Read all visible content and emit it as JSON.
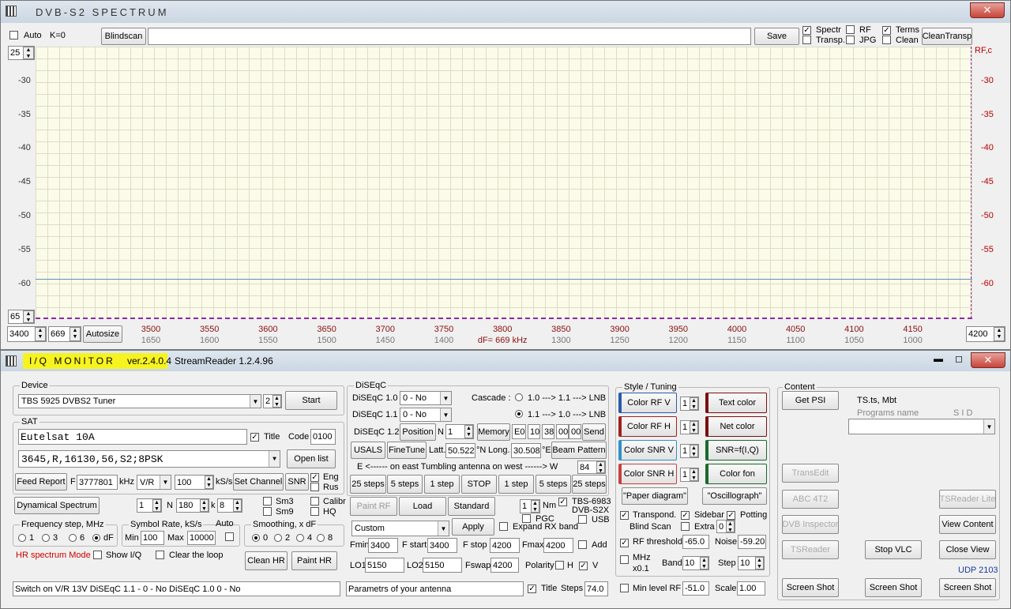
{
  "spectrum": {
    "title": "DVB-S2   SPECTRUM",
    "auto_label": "Auto",
    "k_label": "K=0",
    "blindscan": "Blindscan",
    "save": "Save",
    "checks": {
      "spectr": "Spectr",
      "transp": "Transp.",
      "rf": "RF",
      "jpg": "JPG",
      "terms": "Terms",
      "clean": "Clean"
    },
    "cleantransp": "CleanTransp",
    "top_value": "25",
    "bottom_value": "65",
    "right_label": "RF,c",
    "y_ticks": [
      "-30",
      "-35",
      "-40",
      "-45",
      "-50",
      "-55",
      "-60"
    ],
    "x_top": [
      "3500",
      "3550",
      "3600",
      "3650",
      "3700",
      "3750",
      "3800",
      "3850",
      "3900",
      "3950",
      "4000",
      "4050",
      "4100",
      "4150"
    ],
    "x_bottom": [
      "1650",
      "1600",
      "1550",
      "1500",
      "1450",
      "1400",
      "dF= 669 kHz",
      "1300",
      "1250",
      "1200",
      "1150",
      "1100",
      "1050",
      "1000"
    ],
    "start_freq": "3400",
    "span": "669",
    "autosize": "Autosize",
    "end_freq": "4200"
  },
  "monitor": {
    "title": "I/Q  MONITOR",
    "version": "ver.2.4.0.4",
    "streamreader": "StreamReader 1.2.4.96",
    "device": {
      "legend": "Device",
      "tuner": "TBS 5925 DVBS2 Tuner",
      "num": "2",
      "start": "Start"
    },
    "sat": {
      "legend": "SAT",
      "name": "Eutelsat 10A",
      "title": "Title",
      "code_label": "Code",
      "code": "0100",
      "tp": "3645,R,16130,56,S2;8PSK",
      "openlist": "Open list",
      "feed": "Feed Report",
      "f_label": "F",
      "f_value": "3777801",
      "khz": "kHz",
      "vr": "V/R",
      "sr": "100",
      "ks": "kS/s",
      "setchannel": "Set Channel",
      "snr": "SNR",
      "eng": "Eng",
      "rus": "Rus"
    },
    "dyn": {
      "button": "Dynamical  Spectrum",
      "v1": "1",
      "n_label": "N",
      "n_val": "180",
      "k_label": "k",
      "k_val": "8",
      "sm3": "Sm3",
      "sm9": "Sm9",
      "calibr": "Calibr",
      "hq": "HQ"
    },
    "freqstep": {
      "legend": "Frequency step, MHz",
      "o1": "1",
      "o3": "3",
      "o6": "6",
      "odf": "dF"
    },
    "symrate": {
      "legend": "Symbol Rate, kS/s",
      "min_label": "Min",
      "min": "100",
      "max_label": "Max",
      "max": "10000",
      "auto": "Auto"
    },
    "smooth": {
      "legend": "Smoothing, x dF",
      "o0": "0",
      "o2": "2",
      "o4": "4",
      "o8": "8"
    },
    "hr": {
      "mode": "HR spectrum Mode",
      "showiq": "Show I/Q",
      "clearloop": "Clear the loop",
      "cleanhr": "Clean HR",
      "painthr": "Paint HR"
    },
    "status_left": "Switch on V/R  13V    DiSEqC 1.1 - 0 - No     DiSEqC 1.0 0 - No",
    "diseqc": {
      "legend": "DiSEqC",
      "d10": "DiSEqC 1.0",
      "d10v": "0 - No",
      "d11": "DiSEqC 1.1",
      "d11v": "0 - No",
      "d12": "DiSEqC 1.2",
      "cascade": "Cascade :",
      "c1": "1.0 ---> 1.1 ---> LNB",
      "c2": "1.1 ---> 1.0 ---> LNB",
      "position": "Position",
      "n": "N",
      "nval": "1",
      "memory": "Memory",
      "e0": "E0",
      "v10": "10",
      "v38": "38",
      "v00a": "00",
      "v00b": "00",
      "send": "Send",
      "usals": "USALS",
      "finetune": "FineTune",
      "latt": "Latt.",
      "lattv": "50.522",
      "north": "°N",
      "long": "Long.",
      "longv": "30.508",
      "east": "°E",
      "beam": "Beam Pattern",
      "eastline": "E  <------  on  east   Tumbling antenna     on  west  ------> W",
      "w84": "84",
      "steps": [
        "25 steps",
        "5 steps",
        "1 step",
        "STOP",
        "1 step",
        "5 steps",
        "25 steps"
      ]
    },
    "paint": {
      "paintrf": "Paint RF",
      "load": "Load",
      "standard": "Standard",
      "one": "1",
      "nm": "Nm",
      "pgc": "PGC",
      "tbs": "TBS-6983",
      "dvbs2x": "DVB-S2X",
      "usb": "USB"
    },
    "custom": {
      "sel": "Custom",
      "apply": "Apply",
      "expand": "Expand RX band",
      "fmin": "Fmin",
      "fminv": "3400",
      "fstart": "F start",
      "fstartv": "3400",
      "fstop": "F stop",
      "fstopv": "4200",
      "fmax": "Fmax",
      "fmaxv": "4200",
      "add": "Add",
      "lo1": "LO1",
      "lo1v": "5150",
      "lo2": "LO2",
      "lo2v": "5150",
      "fswap": "Fswap",
      "fswapv": "4200",
      "polarity": "Polarity",
      "h": "H",
      "v": "V"
    },
    "params": {
      "text": "Parametrs of your antenna",
      "title": "Title",
      "steps": "Steps",
      "stepsv": "74.0"
    },
    "style": {
      "legend": "Style / Tuning",
      "rfv": "Color  RF V",
      "rfh": "Color  RF H",
      "snrv": "Color  SNR V",
      "snrh": "Color  SNR H",
      "one": "1",
      "textcolor": "Text color",
      "netcolor": "Net color",
      "snrf": "SNR=f(I,Q)",
      "colorfon": "Color fon",
      "paper": "\"Paper diagram\"",
      "osc": "\"Oscillograph\"",
      "transpond": "Transpond.",
      "sidebar": "Sidebar",
      "potting": "Potting",
      "blind": "Blind  Scan",
      "extra": "Extra",
      "zero": "0",
      "rfthr": "RF threshold",
      "rfthrv": "-65.0",
      "noise": "Noise",
      "noisev": "-59.20",
      "mhz": "MHz",
      "x01": "x0.1",
      "band": "Band",
      "bandv": "10",
      "step": "Step",
      "stepv": "10",
      "minlevel": "Min level RF",
      "minlevelv": "-51.0",
      "scale": "Scale",
      "scalev": "1.00"
    },
    "content": {
      "legend": "Content",
      "getpsi": "Get  PSI",
      "tsts": "TS.ts,  Mbt",
      "progname": "Programs  name",
      "sid": "S I D",
      "transedit": "TransEdit",
      "abc": "ABC 4T2",
      "dvbinsp": "DVB Inspector",
      "tsreader": "TSReader",
      "tsreaderlite": "TSReader Lite",
      "viewcontent": "View Content",
      "stopvlc": "Stop  VLC",
      "closeview": "Close View",
      "udp": "UDP 2103",
      "shot1": "Screen Shot",
      "shot2": "Screen Shot",
      "shot3": "Screen Shot"
    }
  }
}
